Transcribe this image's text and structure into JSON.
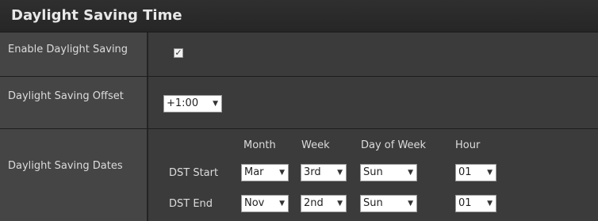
{
  "section": {
    "title": "Daylight Saving Time"
  },
  "enable": {
    "label": "Enable Daylight Saving",
    "checked_mark": "✓"
  },
  "offset": {
    "label": "Daylight Saving Offset",
    "value": "+1:00"
  },
  "dates": {
    "label": "Daylight Saving Dates",
    "columns": {
      "month": "Month",
      "week": "Week",
      "day": "Day of Week",
      "hour": "Hour"
    },
    "start": {
      "label": "DST Start",
      "month": "Mar",
      "week": "3rd",
      "day": "Sun",
      "hour": "01"
    },
    "end": {
      "label": "DST End",
      "month": "Nov",
      "week": "2nd",
      "day": "Sun",
      "hour": "01"
    }
  },
  "icons": {
    "dropdown_arrow": "▼"
  }
}
